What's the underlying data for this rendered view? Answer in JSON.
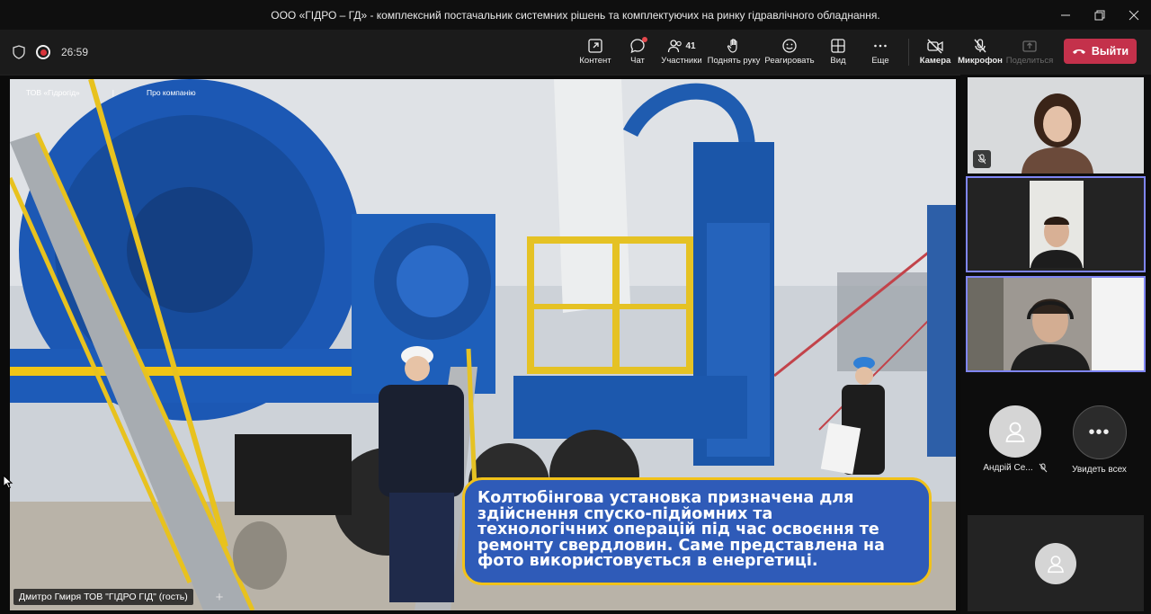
{
  "window": {
    "title": "ООО «ГІДРО – ГД» - комплексний постачальник системних рішень та комплектуючих на ринку гідравлічного обладнання."
  },
  "meeting": {
    "timer": "26:59"
  },
  "toolbar": {
    "content": "Контент",
    "chat": "Чат",
    "participants_count": "41",
    "participants": "Участники",
    "raise_hand": "Поднять руку",
    "react": "Реагировать",
    "view": "Вид",
    "more": "Еще",
    "camera": "Камера",
    "mic": "Микрофон",
    "share": "Поделиться",
    "leave": "Выйти"
  },
  "slide": {
    "nav_company": "ТОВ «Гідрогід»",
    "nav_separator": "|",
    "nav_about": "Про компанію",
    "caption_lines": [
      "Колтюбінгова установка призначена для",
      "здійснення спуско-підйомних та",
      "технологічних операцій під час освоєння те",
      "ремонту свердловин. Саме представлена на",
      "фото використовується в енергетиці."
    ],
    "presenter_name": "Дмитро Гмиря ТОВ \"ГІДРО ГІД\" (гость)"
  },
  "participants_panel": {
    "andriy_name": "Андрій Се...",
    "see_all": "Увидеть всех"
  },
  "colors": {
    "leave_button": "#c4314b",
    "active_speaker_border": "#7f85f5",
    "caption_bg": "#2f5bb8",
    "caption_border": "#f1c21a"
  }
}
